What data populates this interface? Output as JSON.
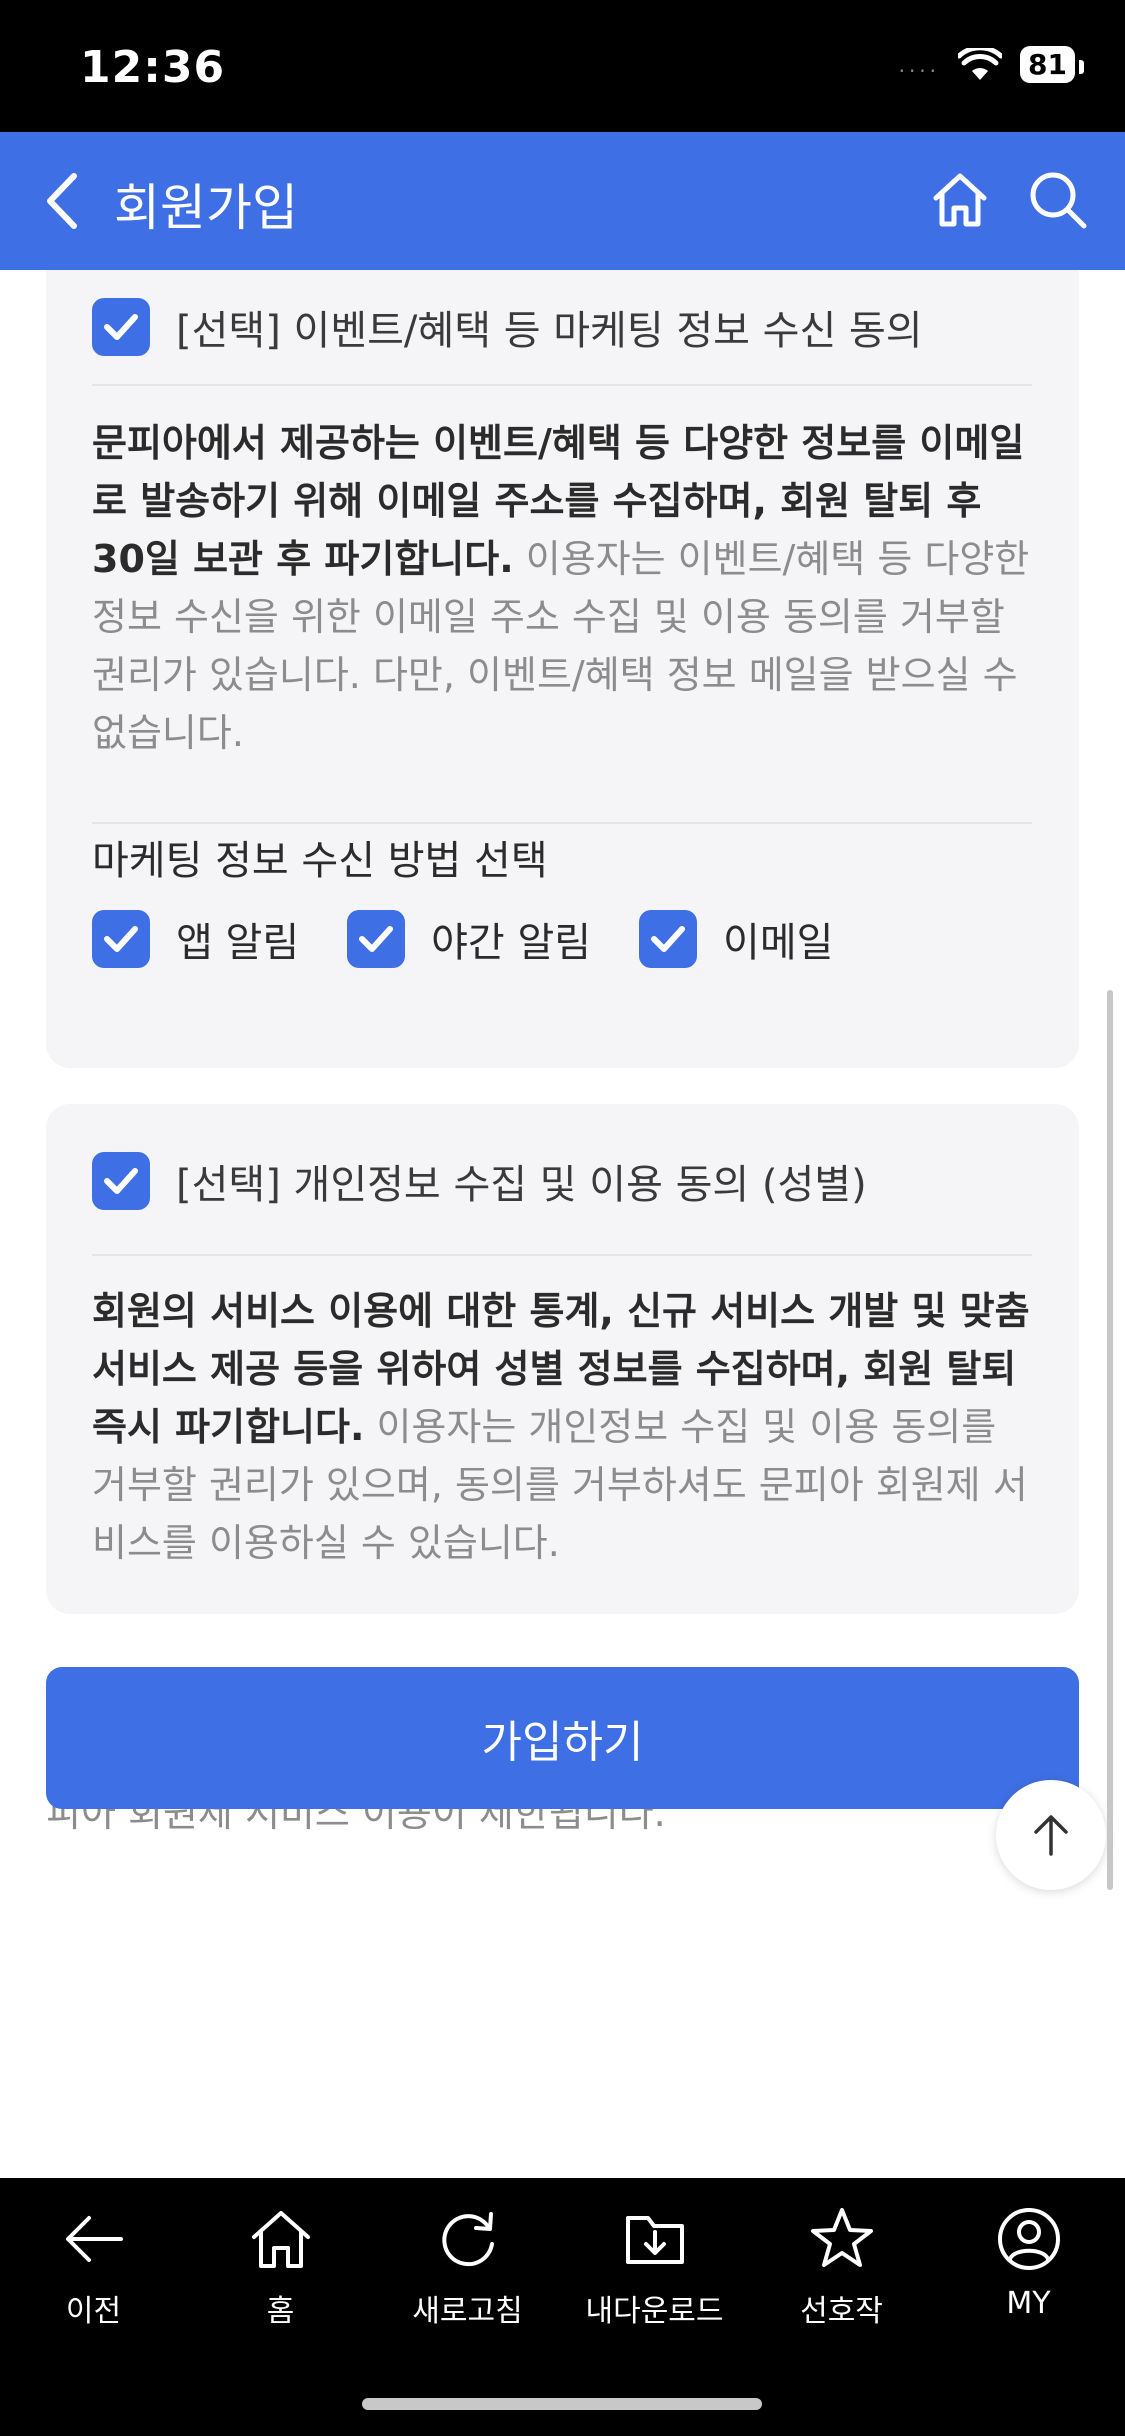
{
  "status_bar": {
    "time": "12:36",
    "signal": "....",
    "battery": "81"
  },
  "header": {
    "title": "회원가입",
    "back_icon": "chevron-left-icon",
    "home_icon": "home-icon",
    "search_icon": "search-icon"
  },
  "marketing_consent": {
    "label": "[선택] 이벤트/혜택 등 마케팅 정보 수신 동의",
    "checked": true,
    "description_bold": "문피아에서 제공하는 이벤트/혜택 등 다양한 정보를 이메일로 발송하기 위해 이메일 주소를 수집하며, 회원 탈퇴 후 30일 보관 후 파기합니다.",
    "description_normal": " 이용자는 이벤트/혜택 등 다양한 정보 수신을 위한 이메일 주소 수집 및 이용 동의를 거부할 권리가 있습니다. 다만, 이벤트/혜택 정보 메일을 받으실 수 없습니다.",
    "method_title": "마케팅 정보 수신 방법 선택",
    "methods": [
      {
        "label": "앱 알림",
        "checked": true
      },
      {
        "label": "야간 알림",
        "checked": true
      },
      {
        "label": "이메일",
        "checked": true
      }
    ]
  },
  "gender_consent": {
    "label": "[선택] 개인정보 수집 및 이용 동의 (성별)",
    "checked": true,
    "description_bold": "회원의 서비스 이용에 대한 통계, 신규 서비스 개발 및 맞춤 서비스 제공 등을 위하여 성별 정보를 수집하며, 회원 탈퇴 즉시 파기합니다.",
    "description_normal": " 이용자는 개인정보 수집 및 이용 동의를 거부할 권리가 있으며, 동의를 거부하셔도 문피아 회원제 서비스를 이용하실 수 있습니다."
  },
  "notice": "고객님께서는 문피아의 회원제 서비스 이용에 필요한 최소한의 개인정보 수집·이용에 동의하지 않을 권리가 있으며, 거부 시에는 문피아 회원제 서비스 이용이 제한됩니다.",
  "join_button": "가입하기",
  "scroll_top_icon": "arrow-up-icon",
  "accent_color": "#3f6fe4",
  "bottom_nav": [
    {
      "label": "이전",
      "icon": "arrow-left-icon"
    },
    {
      "label": "홈",
      "icon": "home-icon"
    },
    {
      "label": "새로고침",
      "icon": "refresh-icon"
    },
    {
      "label": "내다운로드",
      "icon": "download-folder-icon"
    },
    {
      "label": "선호작",
      "icon": "star-icon"
    },
    {
      "label": "MY",
      "icon": "user-icon"
    }
  ]
}
